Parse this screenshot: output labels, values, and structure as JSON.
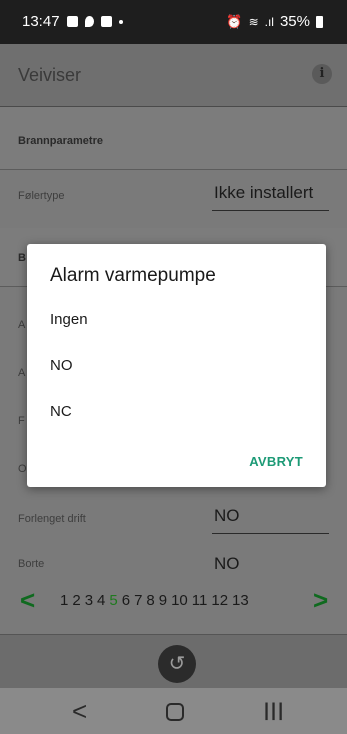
{
  "status_bar": {
    "time": "13:47",
    "battery": "35%"
  },
  "app_bar": {
    "title": "Veiviser",
    "info_icon": "i"
  },
  "section_brann": {
    "title": "Brannparametre"
  },
  "folertype": {
    "label": "Følertype",
    "value": "Ikke installert"
  },
  "section_b_hidden": {
    "title_fragment": "B"
  },
  "hidden_rows": [
    {
      "label_fragment": "A"
    },
    {
      "label_fragment": "A"
    },
    {
      "label_fragment": "F"
    },
    {
      "label_fragment": "O"
    }
  ],
  "forlenget_drift": {
    "label": "Forlenget drift",
    "value": "NO"
  },
  "borte": {
    "label": "Borte",
    "value": "NO"
  },
  "pager": {
    "prev": "<",
    "next": ">",
    "pages": [
      "1",
      "2",
      "3",
      "4",
      "5",
      "6",
      "7",
      "8",
      "9",
      "10",
      "11",
      "12",
      "13"
    ],
    "active_page": "5"
  },
  "undo_icon": "↺",
  "nav": {
    "back": "<",
    "recent": "|||"
  },
  "dialog": {
    "title": "Alarm varmepumpe",
    "options": [
      "Ingen",
      "NO",
      "NC"
    ],
    "cancel_label": "AVBRYT"
  },
  "colors": {
    "accent_green": "#1d9a76",
    "pager_green": "#0f6a1f"
  }
}
